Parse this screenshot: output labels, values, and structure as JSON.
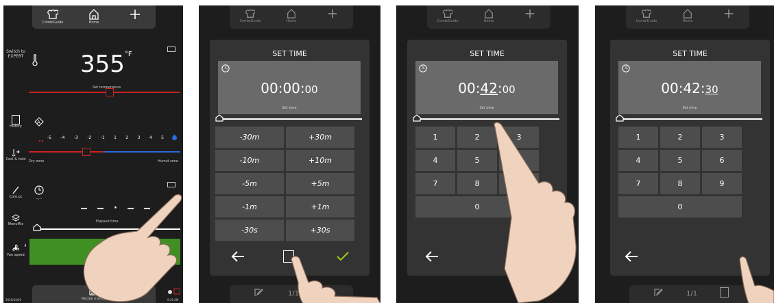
{
  "nav": {
    "combiguide": "CombiGuide",
    "home": "Home"
  },
  "p1": {
    "expert": "Switch to EXPERT",
    "temp_value": "355",
    "temp_unit": "°F",
    "temp_label": "Set temperature",
    "history": "History",
    "cool_hold": "Cool & hold",
    "core_pc": "Core pc",
    "menumix": "MenuMix",
    "fan_speed": "Fan speed",
    "fan_level": "4",
    "scale": [
      "-5",
      "-4",
      "-3",
      "-2",
      "-1",
      "1",
      "2",
      "3",
      "4",
      "5"
    ],
    "dry_zone": "Dry zone",
    "humid_zone": "Humid zone",
    "timer_small": "--:--",
    "elapsed_label": "Elapsed time",
    "recipe_label": "Recipe manager",
    "date": "2025/04/01",
    "clock": "9:30 AM"
  },
  "set_time": {
    "title": "SET TIME",
    "time_label": "Set time",
    "quick_keys": [
      "-30m",
      "+30m",
      "-10m",
      "+10m",
      "-5m",
      "+5m",
      "-1m",
      "+1m",
      "-30s",
      "+30s"
    ],
    "numpad": [
      "1",
      "2",
      "3",
      "4",
      "5",
      "6",
      "7",
      "8",
      "9",
      "0"
    ],
    "p2_time_main": "00:00",
    "p2_time_sec": "00",
    "p3_time_main": "00:",
    "p3_time_underlined": "42",
    "p3_time_sec": "00",
    "p4_time_main": "00:42:",
    "p4_time_underlined": "30",
    "page": "1/1"
  },
  "colors": {
    "accent_red": "#cc2222",
    "accent_blue": "#2a6bd8",
    "check_green": "#9fcf1f",
    "bar_green": "#3f8f23"
  }
}
